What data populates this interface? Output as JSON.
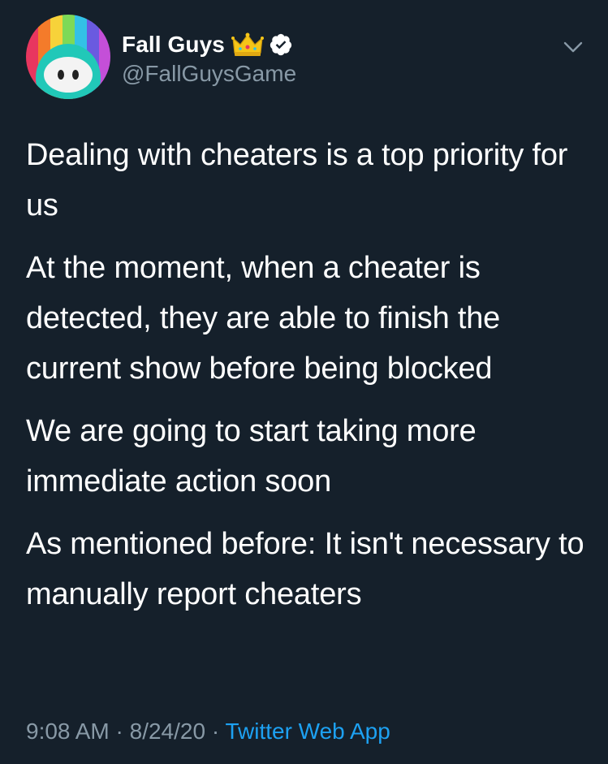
{
  "author": {
    "display_name": "Fall Guys",
    "handle": "@FallGuysGame",
    "avatar_icon": "fall-guys-avatar-icon",
    "badges": [
      "crown-icon",
      "verified-icon"
    ]
  },
  "tweet": {
    "paragraphs": [
      "Dealing with cheaters is a top priority for us",
      "At the moment, when a cheater is detected, they are able to finish the current show before being blocked",
      "We are going to start taking more immediate action soon",
      "As mentioned before: It isn't necessary to manually report cheaters"
    ]
  },
  "meta": {
    "time": "9:08 AM",
    "separator": " · ",
    "date": "8/24/20",
    "source": "Twitter Web App"
  },
  "colors": {
    "background": "#15202b",
    "primary_text": "#ffffff",
    "secondary_text": "#8899a6",
    "link": "#1da1f2",
    "verified": "#ffffff",
    "crown": "#f5c518"
  },
  "icons": {
    "menu": "chevron-down-icon"
  }
}
